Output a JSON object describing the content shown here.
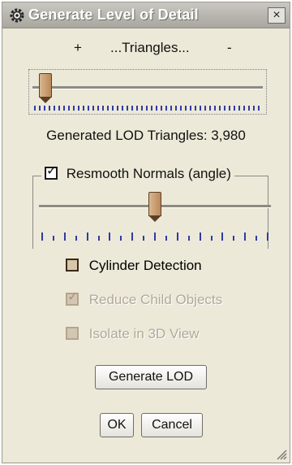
{
  "window": {
    "title": "Generate Level of Detail",
    "close_label": "×"
  },
  "triangles": {
    "plus_label": "+",
    "label": "...Triangles...",
    "minus_label": "-",
    "slider_value": 0.03
  },
  "lod_status": "Generated LOD Triangles: 3,980",
  "resmooth": {
    "label": "Resmooth Normals (angle)",
    "checked": true,
    "slider_value": 0.5
  },
  "options": [
    {
      "label": "Cylinder Detection",
      "checked": false,
      "enabled": true
    },
    {
      "label": "Reduce Child Objects",
      "checked": true,
      "enabled": false
    },
    {
      "label": "Isolate in 3D View",
      "checked": false,
      "enabled": false
    }
  ],
  "buttons": {
    "generate": "Generate LOD",
    "ok": "OK",
    "cancel": "Cancel"
  },
  "icons": [
    "gear-icon",
    "close-icon",
    "resize-grip-icon"
  ]
}
